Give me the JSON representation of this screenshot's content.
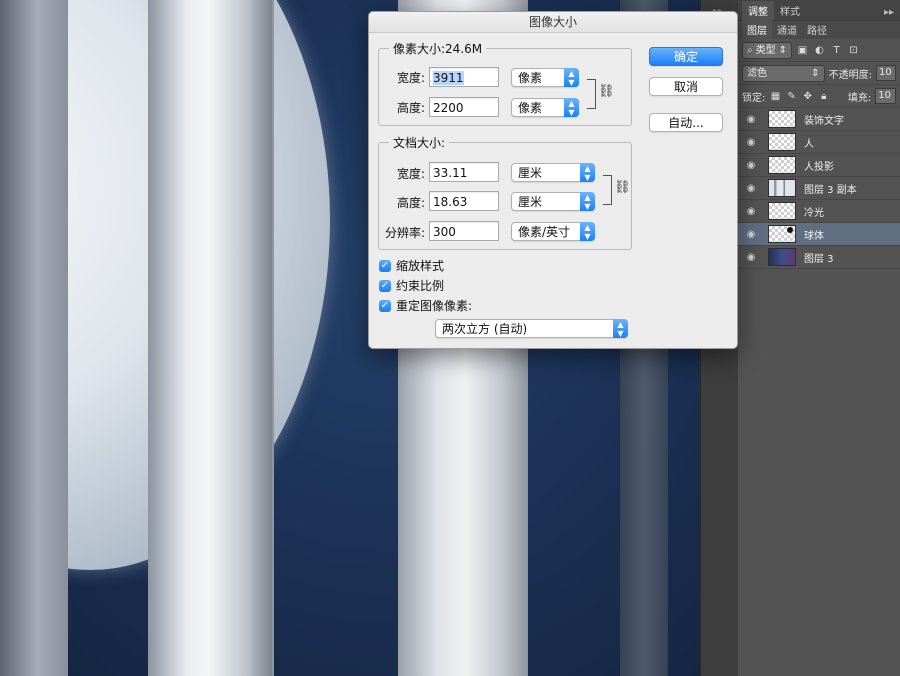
{
  "dialog": {
    "title": "图像大小",
    "pixel_size": {
      "legend": "像素大小:24.6M",
      "width_label": "宽度:",
      "width_value": "3911",
      "width_unit": "像素",
      "height_label": "高度:",
      "height_value": "2200",
      "height_unit": "像素"
    },
    "document_size": {
      "legend": "文档大小:",
      "width_label": "宽度:",
      "width_value": "33.11",
      "width_unit": "厘米",
      "height_label": "高度:",
      "height_value": "18.63",
      "height_unit": "厘米",
      "resolution_label": "分辨率:",
      "resolution_value": "300",
      "resolution_unit": "像素/英寸"
    },
    "checkboxes": [
      {
        "label": "缩放样式",
        "checked": true
      },
      {
        "label": "约束比例",
        "checked": true
      },
      {
        "label": "重定图像像素:",
        "checked": true
      }
    ],
    "resample_method": "两次立方 (自动)",
    "buttons": {
      "ok": "确定",
      "cancel": "取消",
      "auto": "自动..."
    }
  },
  "panel": {
    "top_tabs": [
      "调整",
      "样式"
    ],
    "sub_tabs": [
      "图层",
      "通道",
      "路径"
    ],
    "filter_dropdown": "类型",
    "blend_mode": "滤色",
    "opacity_label": "不透明度:",
    "opacity_value": "10",
    "lock_label": "锁定:",
    "fill_label": "填充:",
    "fill_value": "10",
    "layers": [
      {
        "name": "装饰文字",
        "thumb": "transparent",
        "selected": false
      },
      {
        "name": "人",
        "thumb": "transparent",
        "selected": false
      },
      {
        "name": "人投影",
        "thumb": "transparent",
        "selected": false
      },
      {
        "name": "图层 3 副本",
        "thumb": "stripe",
        "selected": false
      },
      {
        "name": "冷光",
        "thumb": "transparent",
        "selected": false
      },
      {
        "name": "球体",
        "thumb": "transparent-dot",
        "selected": true
      },
      {
        "name": "图层 3",
        "thumb": "dark",
        "selected": false
      }
    ]
  },
  "colors": {
    "accent": "#1b7ff6",
    "panel_bg": "#535353",
    "selected_layer": "#606e82"
  }
}
